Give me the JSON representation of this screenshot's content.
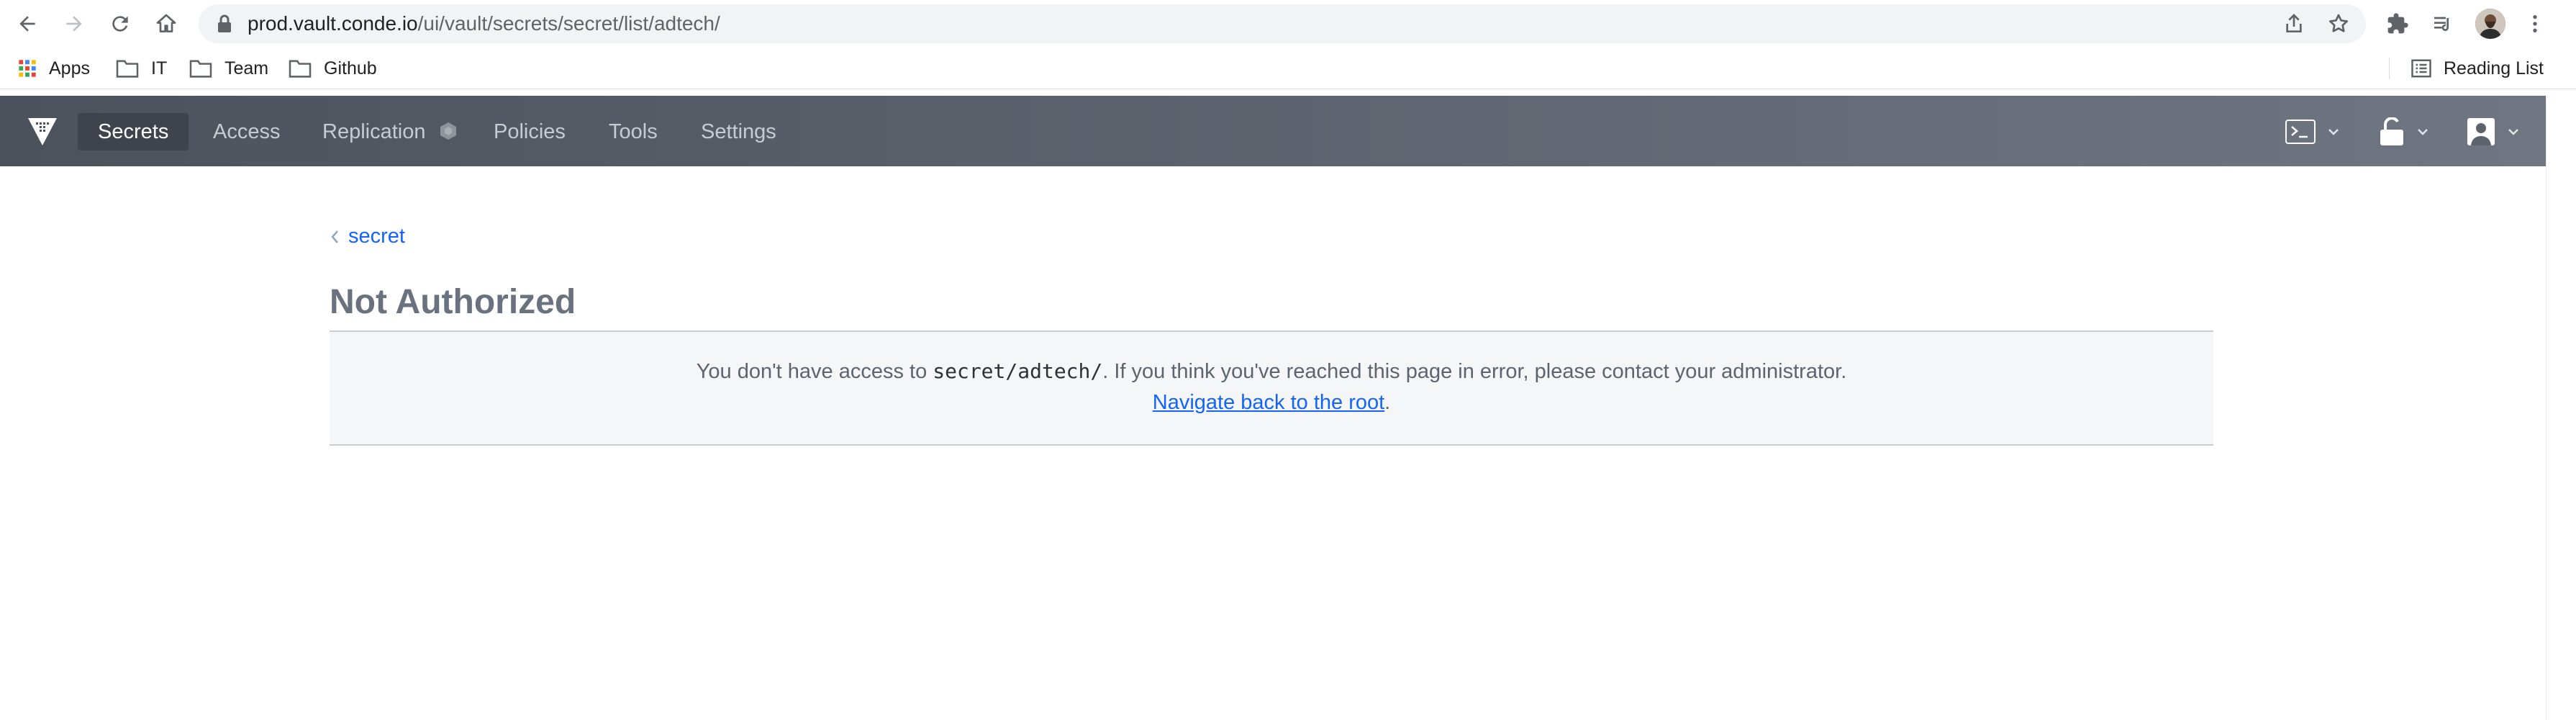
{
  "browser": {
    "url_host": "prod.vault.conde.io",
    "url_path": "/ui/vault/secrets/secret/list/adtech/",
    "bookmarks": [
      {
        "label": "Apps",
        "icon": "apps-grid-icon"
      },
      {
        "label": "IT",
        "icon": "folder-icon"
      },
      {
        "label": "Team",
        "icon": "folder-icon"
      },
      {
        "label": "Github",
        "icon": "folder-icon"
      }
    ],
    "reading_list": "Reading List"
  },
  "app": {
    "nav": {
      "items": [
        {
          "label": "Secrets",
          "active": true
        },
        {
          "label": "Access",
          "active": false
        },
        {
          "label": "Replication",
          "active": false
        },
        {
          "label": "Policies",
          "active": false
        },
        {
          "label": "Tools",
          "active": false
        },
        {
          "label": "Settings",
          "active": false
        }
      ]
    },
    "breadcrumb": "secret",
    "title": "Not Authorized",
    "message": {
      "prefix": "You don't have access to ",
      "path": "secret/adtech/",
      "suffix": ". If you think you've reached this page in error, please contact your administrator.",
      "link_text": "Navigate back to the root",
      "link_suffix": "."
    }
  },
  "colors": {
    "nav_bg_start": "#4c525b",
    "nav_bg_end": "#6f7682",
    "link": "#1563ff",
    "title": "#6a7280"
  }
}
